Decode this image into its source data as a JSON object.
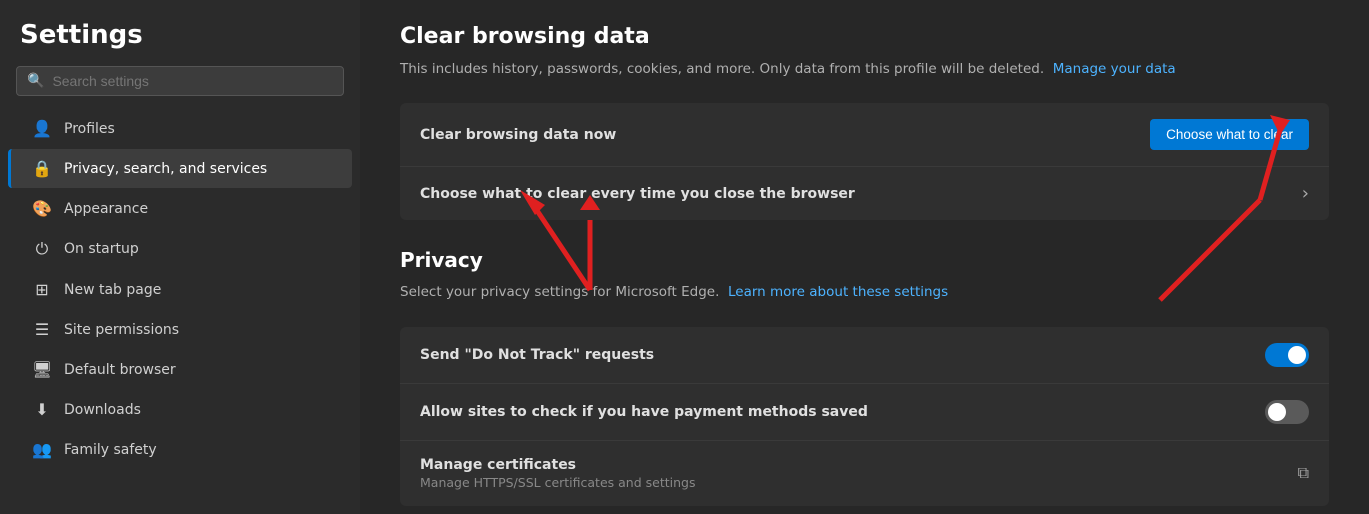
{
  "sidebar": {
    "title": "Settings",
    "search": {
      "placeholder": "Search settings",
      "value": ""
    },
    "items": [
      {
        "id": "profiles",
        "label": "Profiles",
        "icon": "👤"
      },
      {
        "id": "privacy",
        "label": "Privacy, search, and services",
        "icon": "🔒",
        "active": true
      },
      {
        "id": "appearance",
        "label": "Appearance",
        "icon": "🎨"
      },
      {
        "id": "startup",
        "label": "On startup",
        "icon": "⏻"
      },
      {
        "id": "newtab",
        "label": "New tab page",
        "icon": "⊞"
      },
      {
        "id": "sitepermissions",
        "label": "Site permissions",
        "icon": "⊟"
      },
      {
        "id": "defaultbrowser",
        "label": "Default browser",
        "icon": "🖥"
      },
      {
        "id": "downloads",
        "label": "Downloads",
        "icon": "⬇"
      },
      {
        "id": "familysafety",
        "label": "Family safety",
        "icon": "👥"
      }
    ]
  },
  "main": {
    "clear_browsing": {
      "title": "Clear browsing data",
      "description": "This includes history, passwords, cookies, and more. Only data from this profile will be deleted.",
      "manage_link": "Manage your data",
      "clear_now_label": "Clear browsing data now",
      "choose_btn": "Choose what to clear",
      "every_time_label": "Choose what to clear every time you close the browser"
    },
    "privacy": {
      "title": "Privacy",
      "description": "Select your privacy settings for Microsoft Edge.",
      "learn_link": "Learn more about these settings",
      "items": [
        {
          "id": "dnt",
          "label": "Send \"Do Not Track\" requests",
          "toggle": "on"
        },
        {
          "id": "payment",
          "label": "Allow sites to check if you have payment methods saved",
          "toggle": "off"
        },
        {
          "id": "certs",
          "label": "Manage certificates",
          "sublabel": "Manage HTTPS/SSL certificates and settings",
          "type": "link"
        }
      ]
    }
  }
}
